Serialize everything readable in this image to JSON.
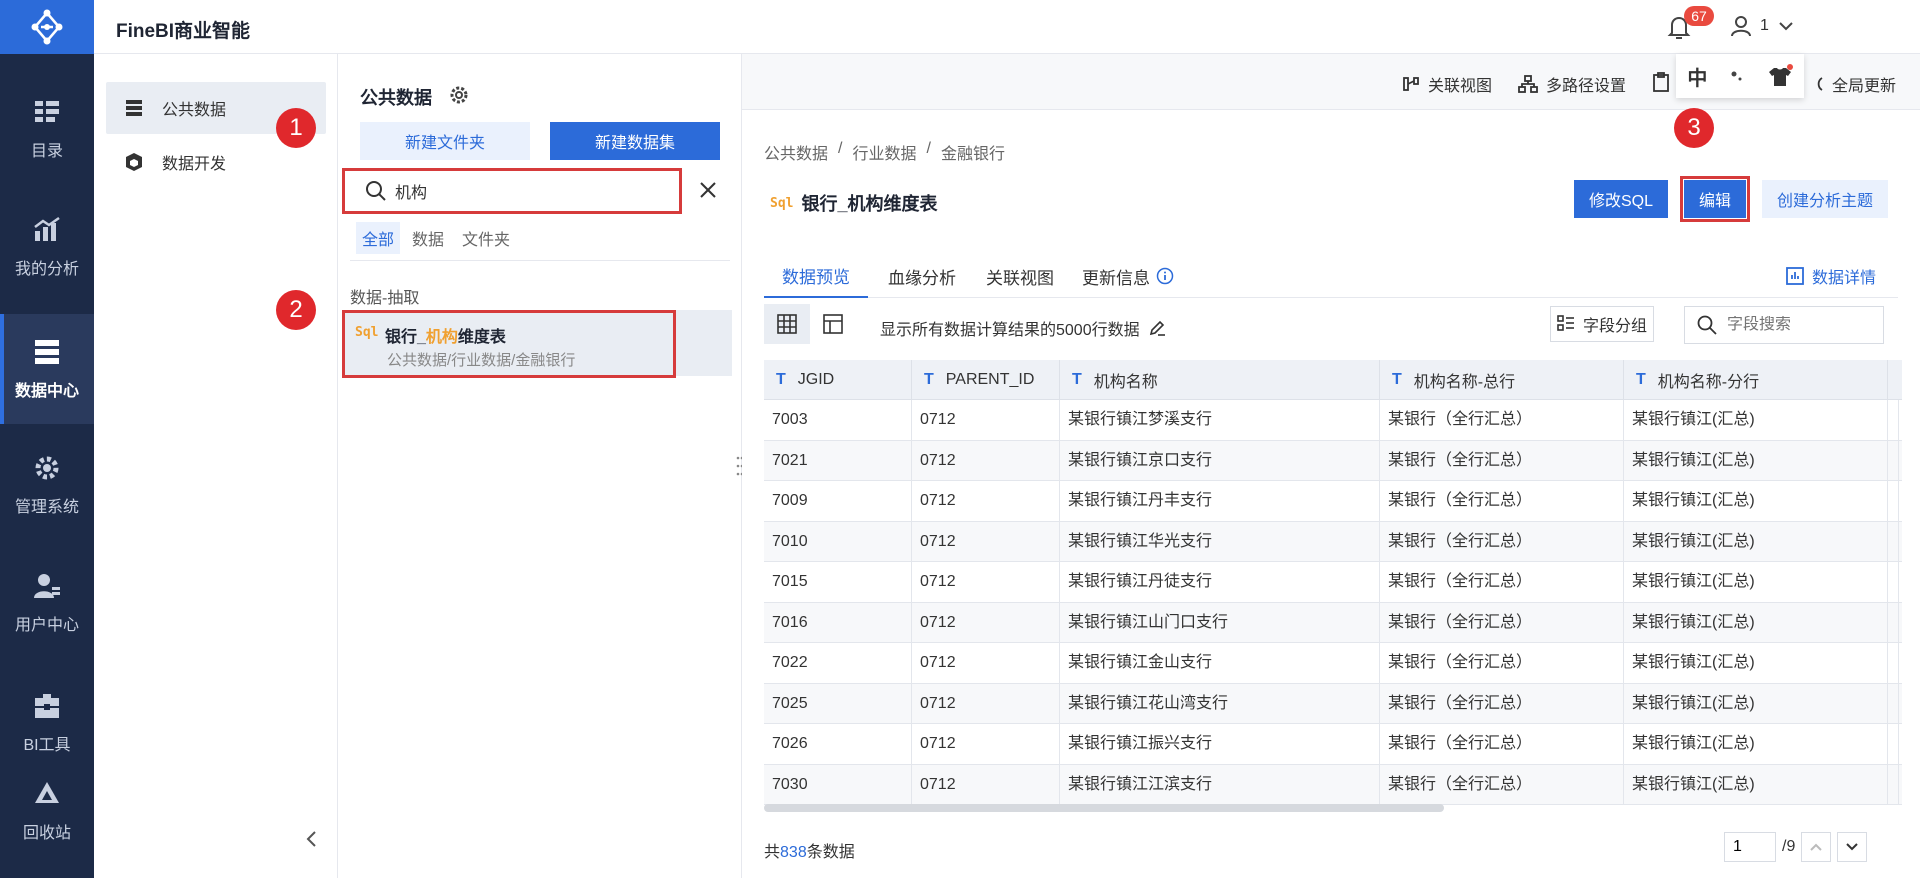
{
  "app": {
    "title": "FineBI商业智能"
  },
  "header": {
    "notification_count": "67",
    "user_name": "1"
  },
  "rail": {
    "items": [
      {
        "label": "目录",
        "icon": "catalog-icon"
      },
      {
        "label": "我的分析",
        "icon": "analysis-icon"
      },
      {
        "label": "数据中心",
        "icon": "data-center-icon",
        "active": true
      },
      {
        "label": "管理系统",
        "icon": "gear-icon"
      },
      {
        "label": "用户中心",
        "icon": "user-icon"
      },
      {
        "label": "BI工具",
        "icon": "toolbox-icon"
      },
      {
        "label": "回收站",
        "icon": "recycle-icon"
      }
    ]
  },
  "subside": {
    "items": [
      {
        "label": "公共数据",
        "active": true
      },
      {
        "label": "数据开发"
      }
    ]
  },
  "tree": {
    "title": "公共数据",
    "new_folder": "新建文件夹",
    "new_dataset": "新建数据集",
    "search_value": "机构",
    "filters": [
      "全部",
      "数据",
      "文件夹"
    ],
    "group_label": "数据-抽取",
    "result": {
      "sql_badge": "Sql",
      "title_prefix": "银行_",
      "title_highlight": "机构",
      "title_suffix": "维度表",
      "path": "公共数据/行业数据/金融银行"
    }
  },
  "steps": [
    "1",
    "2",
    "3"
  ],
  "toolbar": {
    "relation_view": "关联视图",
    "multi_path": "多路径设置",
    "global_update": "全局更新",
    "ime_char": "中"
  },
  "breadcrumb": [
    "公共数据",
    "/",
    "行业数据",
    "/",
    "金融银行"
  ],
  "dataset": {
    "sql_badge": "Sql",
    "name": "银行_机构维度表",
    "btn_sql": "修改SQL",
    "btn_edit": "编辑",
    "btn_topic": "创建分析主题"
  },
  "tabs": [
    "数据预览",
    "血缘分析",
    "关联视图",
    "更新信息"
  ],
  "detail_link": "数据详情",
  "preview": {
    "hint": "显示所有数据计算结果的5000行数据",
    "group_btn": "字段分组",
    "search_placeholder": "字段搜索"
  },
  "table": {
    "columns": [
      "JGID",
      "PARENT_ID",
      "机构名称",
      "机构名称-总行",
      "机构名称-分行"
    ],
    "type_glyph": "T",
    "rows": [
      [
        "7003",
        "0712",
        "某银行镇江梦溪支行",
        "某银行（全行汇总）",
        "某银行镇江(汇总)"
      ],
      [
        "7021",
        "0712",
        "某银行镇江京口支行",
        "某银行（全行汇总）",
        "某银行镇江(汇总)"
      ],
      [
        "7009",
        "0712",
        "某银行镇江丹丰支行",
        "某银行（全行汇总）",
        "某银行镇江(汇总)"
      ],
      [
        "7010",
        "0712",
        "某银行镇江华光支行",
        "某银行（全行汇总）",
        "某银行镇江(汇总)"
      ],
      [
        "7015",
        "0712",
        "某银行镇江丹徒支行",
        "某银行（全行汇总）",
        "某银行镇江(汇总)"
      ],
      [
        "7016",
        "0712",
        "某银行镇江山门口支行",
        "某银行（全行汇总）",
        "某银行镇江(汇总)"
      ],
      [
        "7022",
        "0712",
        "某银行镇江金山支行",
        "某银行（全行汇总）",
        "某银行镇江(汇总)"
      ],
      [
        "7025",
        "0712",
        "某银行镇江花山湾支行",
        "某银行（全行汇总）",
        "某银行镇江(汇总)"
      ],
      [
        "7026",
        "0712",
        "某银行镇江振兴支行",
        "某银行（全行汇总）",
        "某银行镇江(汇总)"
      ],
      [
        "7030",
        "0712",
        "某银行镇江江滨支行",
        "某银行（全行汇总）",
        "某银行镇江(汇总)"
      ]
    ]
  },
  "footer": {
    "count_prefix": "共",
    "count": "838",
    "count_suffix": "条数据",
    "page": "1",
    "total_pages": "/9"
  },
  "colors": {
    "primary": "#2c6bd9",
    "rail": "#1c2a47",
    "highlight": "#d63b3b",
    "step": "#e0282c"
  }
}
